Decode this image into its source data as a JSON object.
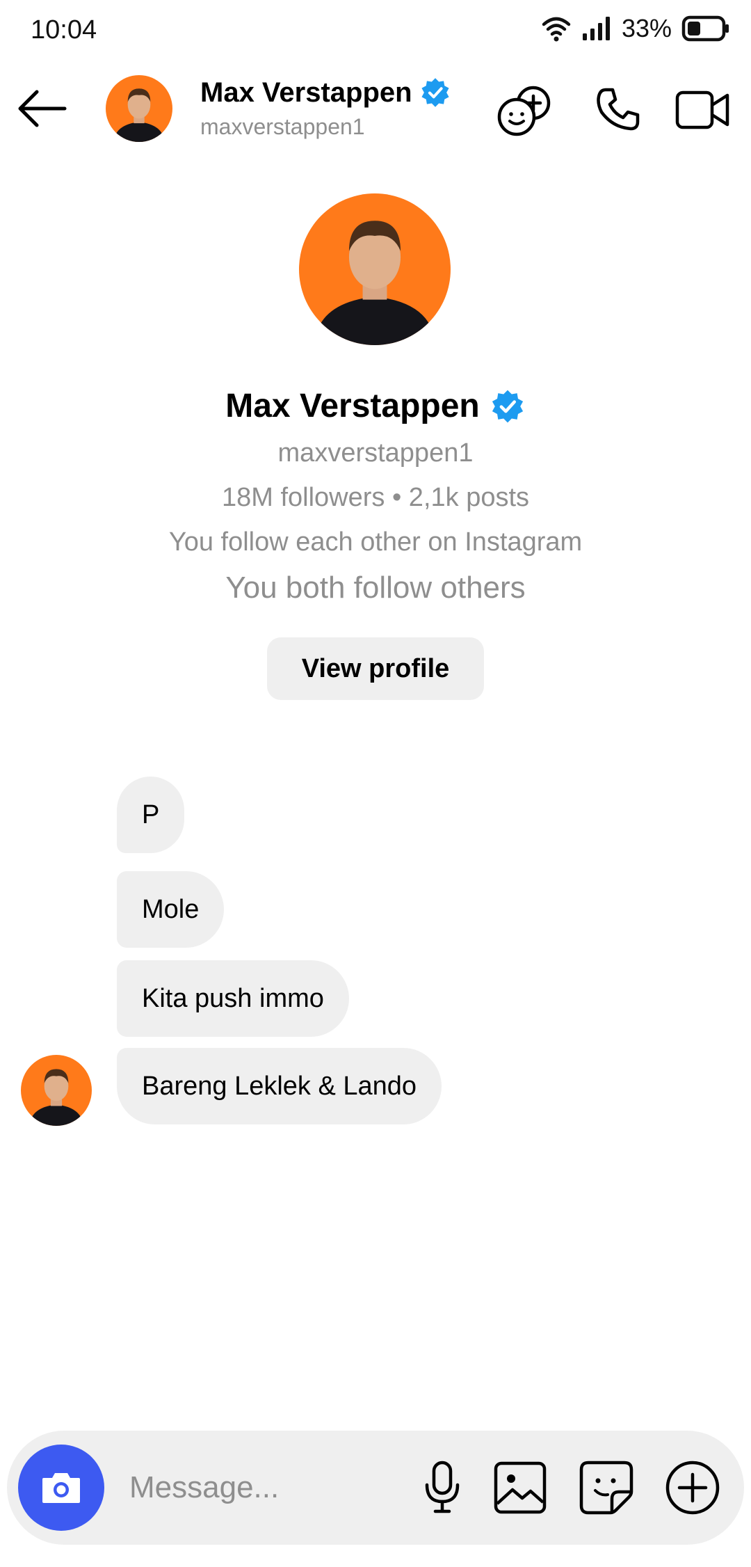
{
  "status_bar": {
    "time": "10:04",
    "battery_percent": "33%",
    "icons": [
      "wifi-icon",
      "signal-icon",
      "battery-icon"
    ]
  },
  "header": {
    "name": "Max Verstappen",
    "username": "maxverstappen1",
    "verified": true,
    "icons": [
      "back-arrow-icon",
      "add-people-icon",
      "phone-icon",
      "video-camera-icon"
    ]
  },
  "profile": {
    "name": "Max Verstappen",
    "username": "maxverstappen1",
    "stats": "18M  followers • 2,1k  posts",
    "mutual_line": "You follow each other on  Instagram",
    "others_line": "You both follow others",
    "view_profile_label": "View profile"
  },
  "messages": [
    {
      "text": "P"
    },
    {
      "text": "Mole"
    },
    {
      "text": "Kita push immo"
    },
    {
      "text": "Bareng Leklek & Lando"
    }
  ],
  "composer": {
    "placeholder": "Message...",
    "icons": [
      "camera-icon",
      "microphone-icon",
      "image-icon",
      "sticker-icon",
      "plus-icon"
    ]
  },
  "colors": {
    "accent": "#3d5af1",
    "verified": "#1d9bf0",
    "bubble": "#efefef",
    "secondary_text": "#8e8e8e",
    "avatar_bg": "#ff7a1a"
  }
}
